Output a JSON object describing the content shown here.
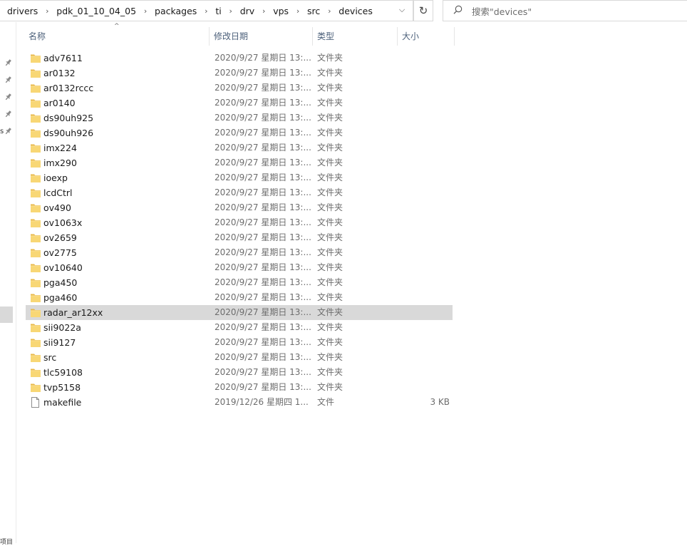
{
  "address": {
    "crumbs": [
      "drivers",
      "pdk_01_10_04_05",
      "packages",
      "ti",
      "drv",
      "vps",
      "src",
      "devices"
    ],
    "separator": "›",
    "dropdown_glyph": "⌵",
    "refresh_glyph": "↻"
  },
  "search": {
    "placeholder": "搜索\"devices\"",
    "icon": "search-icon"
  },
  "columns": {
    "name": "名称",
    "date": "修改日期",
    "type": "类型",
    "size": "大小",
    "sort_glyph": "^"
  },
  "navpane": {
    "pin_glyph": "📌",
    "label_s": "s",
    "label_bottom": "项目"
  },
  "files": [
    {
      "name": "adv7611",
      "date": "2020/9/27 星期日 13:...",
      "type": "文件夹",
      "size": "",
      "kind": "folder"
    },
    {
      "name": "ar0132",
      "date": "2020/9/27 星期日 13:...",
      "type": "文件夹",
      "size": "",
      "kind": "folder"
    },
    {
      "name": "ar0132rccc",
      "date": "2020/9/27 星期日 13:...",
      "type": "文件夹",
      "size": "",
      "kind": "folder"
    },
    {
      "name": "ar0140",
      "date": "2020/9/27 星期日 13:...",
      "type": "文件夹",
      "size": "",
      "kind": "folder"
    },
    {
      "name": "ds90uh925",
      "date": "2020/9/27 星期日 13:...",
      "type": "文件夹",
      "size": "",
      "kind": "folder"
    },
    {
      "name": "ds90uh926",
      "date": "2020/9/27 星期日 13:...",
      "type": "文件夹",
      "size": "",
      "kind": "folder"
    },
    {
      "name": "imx224",
      "date": "2020/9/27 星期日 13:...",
      "type": "文件夹",
      "size": "",
      "kind": "folder"
    },
    {
      "name": "imx290",
      "date": "2020/9/27 星期日 13:...",
      "type": "文件夹",
      "size": "",
      "kind": "folder"
    },
    {
      "name": "ioexp",
      "date": "2020/9/27 星期日 13:...",
      "type": "文件夹",
      "size": "",
      "kind": "folder"
    },
    {
      "name": "lcdCtrl",
      "date": "2020/9/27 星期日 13:...",
      "type": "文件夹",
      "size": "",
      "kind": "folder"
    },
    {
      "name": "ov490",
      "date": "2020/9/27 星期日 13:...",
      "type": "文件夹",
      "size": "",
      "kind": "folder"
    },
    {
      "name": "ov1063x",
      "date": "2020/9/27 星期日 13:...",
      "type": "文件夹",
      "size": "",
      "kind": "folder"
    },
    {
      "name": "ov2659",
      "date": "2020/9/27 星期日 13:...",
      "type": "文件夹",
      "size": "",
      "kind": "folder"
    },
    {
      "name": "ov2775",
      "date": "2020/9/27 星期日 13:...",
      "type": "文件夹",
      "size": "",
      "kind": "folder"
    },
    {
      "name": "ov10640",
      "date": "2020/9/27 星期日 13:...",
      "type": "文件夹",
      "size": "",
      "kind": "folder"
    },
    {
      "name": "pga450",
      "date": "2020/9/27 星期日 13:...",
      "type": "文件夹",
      "size": "",
      "kind": "folder"
    },
    {
      "name": "pga460",
      "date": "2020/9/27 星期日 13:...",
      "type": "文件夹",
      "size": "",
      "kind": "folder"
    },
    {
      "name": "radar_ar12xx",
      "date": "2020/9/27 星期日 13:...",
      "type": "文件夹",
      "size": "",
      "kind": "folder",
      "selected": true
    },
    {
      "name": "sii9022a",
      "date": "2020/9/27 星期日 13:...",
      "type": "文件夹",
      "size": "",
      "kind": "folder"
    },
    {
      "name": "sii9127",
      "date": "2020/9/27 星期日 13:...",
      "type": "文件夹",
      "size": "",
      "kind": "folder"
    },
    {
      "name": "src",
      "date": "2020/9/27 星期日 13:...",
      "type": "文件夹",
      "size": "",
      "kind": "folder"
    },
    {
      "name": "tlc59108",
      "date": "2020/9/27 星期日 13:...",
      "type": "文件夹",
      "size": "",
      "kind": "folder"
    },
    {
      "name": "tvp5158",
      "date": "2020/9/27 星期日 13:...",
      "type": "文件夹",
      "size": "",
      "kind": "folder"
    },
    {
      "name": "makefile",
      "date": "2019/12/26 星期四 1...",
      "type": "文件",
      "size": "3 KB",
      "kind": "file"
    }
  ],
  "colors": {
    "selected_row": "#d9d9d9",
    "folder_body": "#f8d775",
    "folder_tab": "#e8b84a",
    "header_text": "#4c607a"
  }
}
